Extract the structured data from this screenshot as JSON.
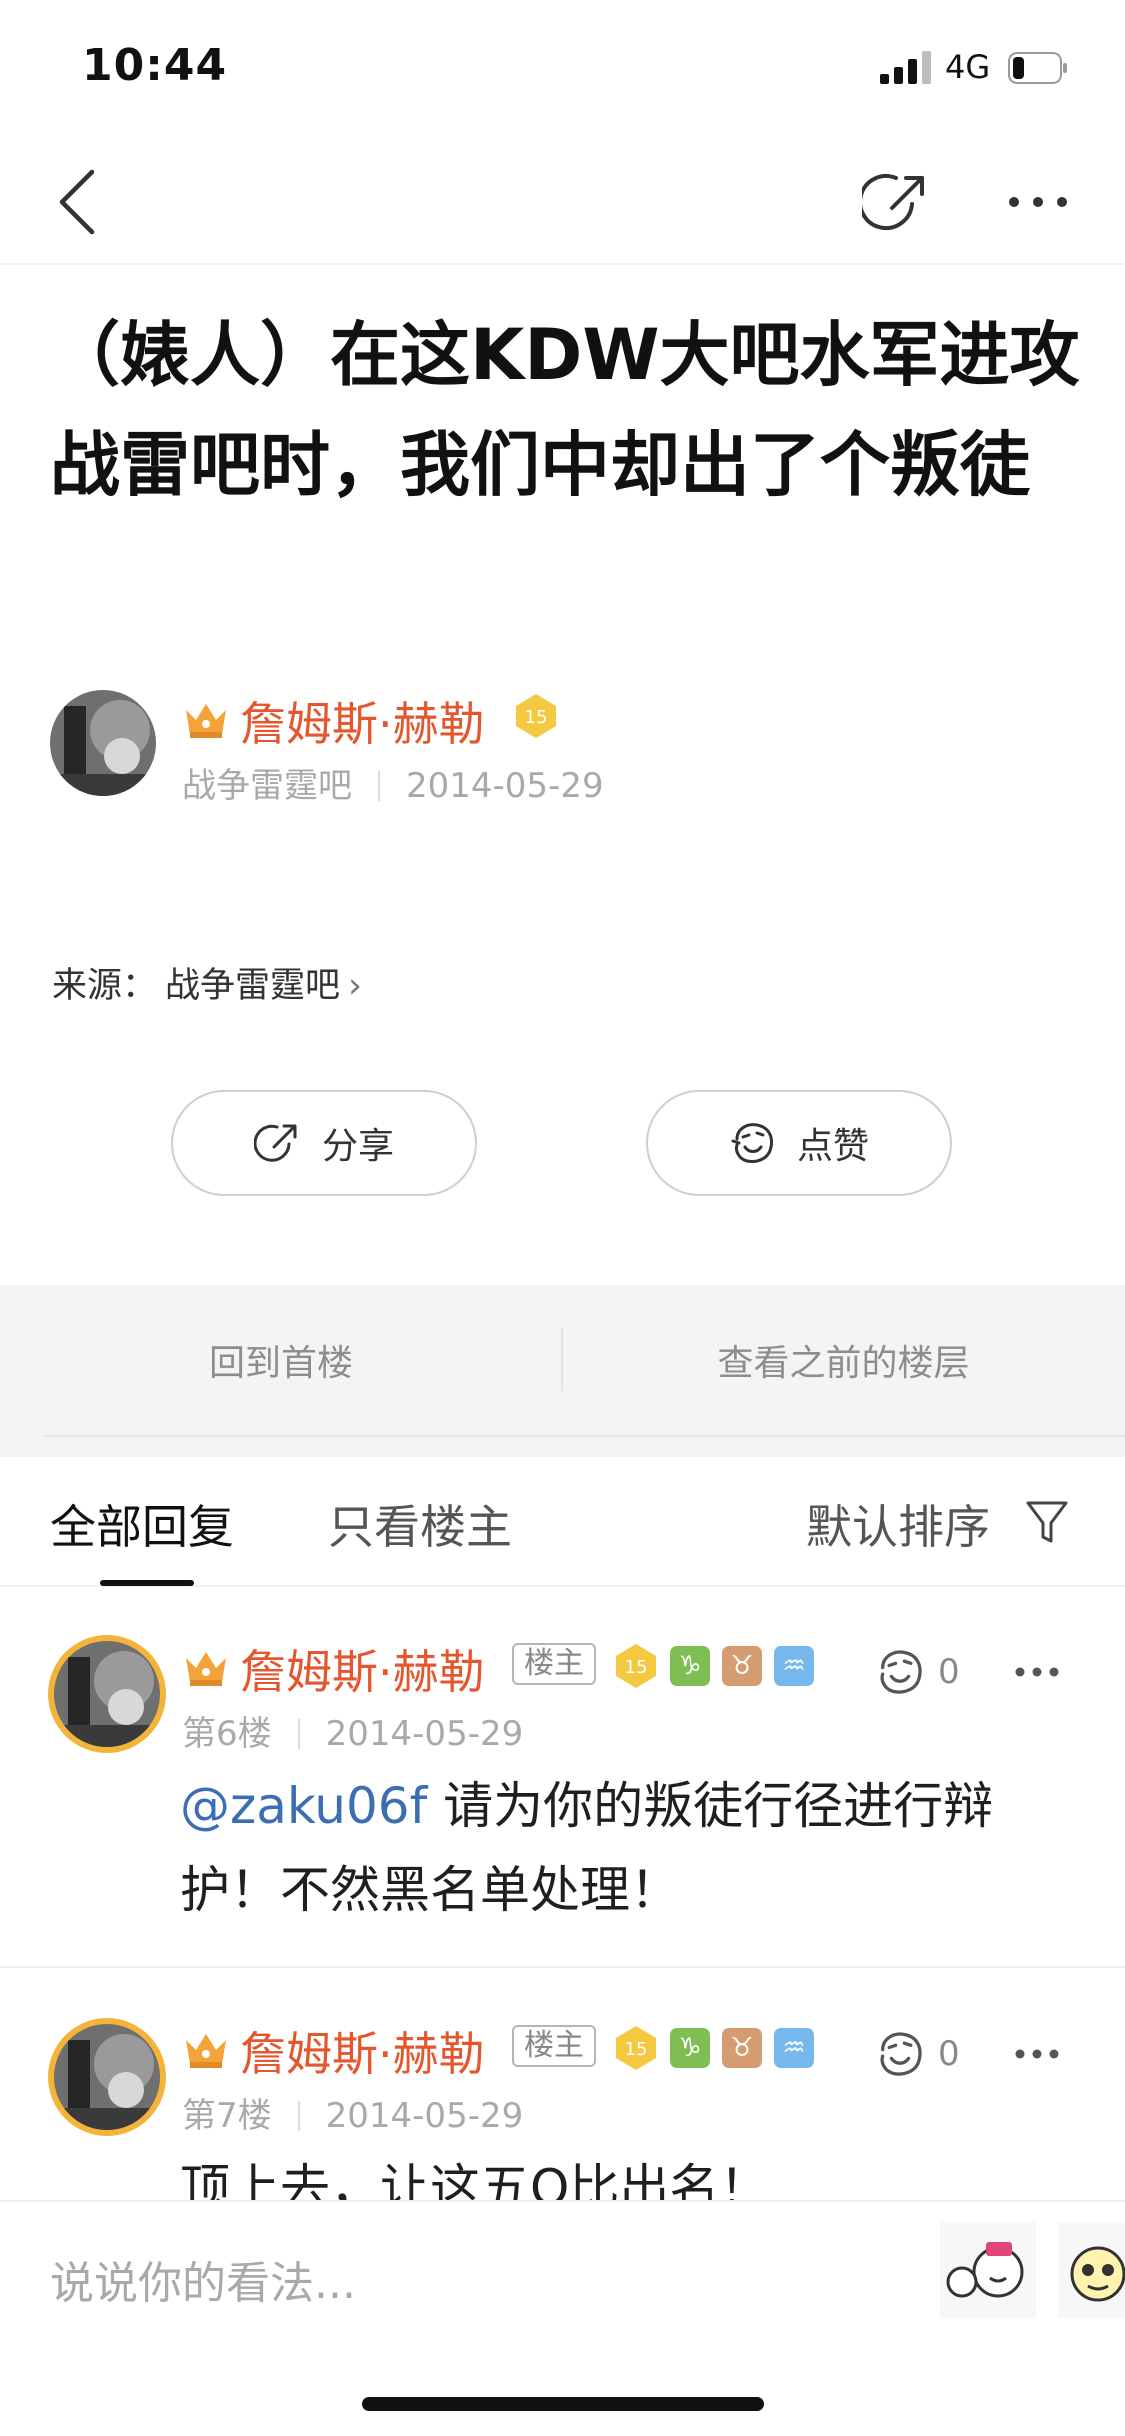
{
  "status_bar": {
    "time": "10:44",
    "network": "4G",
    "signal_icon": "signal-bars-icon",
    "battery_icon": "battery-icon",
    "battery_level": 0.2
  },
  "nav": {
    "back_icon": "chevron-left-icon",
    "share_icon": "share-arrow-icon",
    "more_icon": "more-dots-icon"
  },
  "post": {
    "title": "（婊人）在这KDW大吧水军进攻战雷吧时，我们中却出了个叛徒",
    "author": {
      "name": "詹姆斯·赫勒",
      "level": "15",
      "forum": "战争雷霆吧",
      "date": "2014-05-29"
    },
    "source_label": "来源：",
    "source_name": "战争雷霆吧",
    "source_chevron": "›"
  },
  "actions": {
    "share_label": "分享",
    "like_label": "点赞"
  },
  "floor_nav": {
    "first_floor": "回到首楼",
    "previous_floors": "查看之前的楼层"
  },
  "tabs": {
    "all_replies": "全部回复",
    "op_only": "只看楼主",
    "sort": "默认排序",
    "filter_icon": "filter-funnel-icon"
  },
  "replies": [
    {
      "name": "詹姆斯·赫勒",
      "owner_tag": "楼主",
      "level": "15",
      "zodiac": [
        "♑",
        "♉",
        "♒"
      ],
      "floor": "第6楼",
      "date": "2014-05-29",
      "likes": "0",
      "mention": "@zaku06f",
      "text": " 请为你的叛徒行径进行辩护！不然黑名单处理！"
    },
    {
      "name": "詹姆斯·赫勒",
      "owner_tag": "楼主",
      "level": "15",
      "zodiac": [
        "♑",
        "♉",
        "♒"
      ],
      "floor": "第7楼",
      "date": "2014-05-29",
      "likes": "0",
      "text": "顶上去，让这五Q比出名！"
    }
  ],
  "input_bar": {
    "placeholder": "说说你的看法...",
    "sticker_icons": [
      "sticker-cartoon-icon",
      "sticker-panda-icon"
    ]
  },
  "colors": {
    "name_orange": "#e4572e",
    "mention_blue": "#3c6eb4",
    "crown_gold": "#f2a33a"
  }
}
